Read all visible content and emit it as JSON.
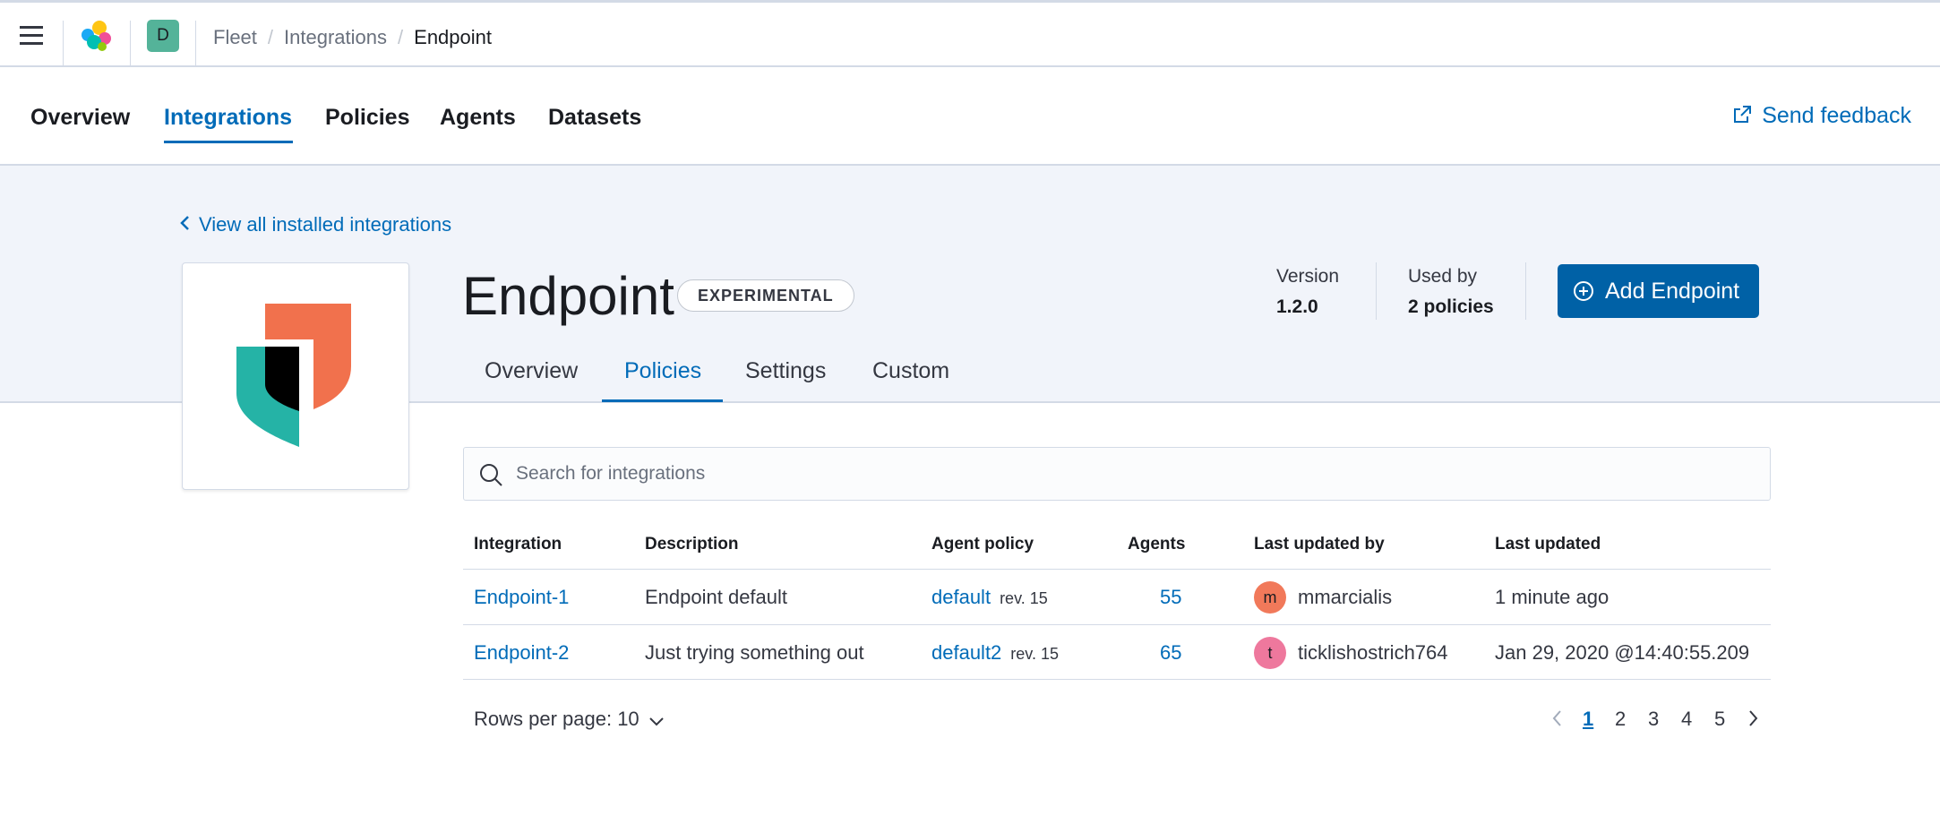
{
  "header": {
    "space_initial": "D",
    "breadcrumbs": [
      "Fleet",
      "Integrations",
      "Endpoint"
    ]
  },
  "main_nav": {
    "tabs": [
      "Overview",
      "Integrations",
      "Policies",
      "Agents",
      "Datasets"
    ],
    "active_tab": "Integrations",
    "feedback_label": "Send feedback"
  },
  "integration": {
    "back_link": "View all installed integrations",
    "title": "Endpoint",
    "badge": "EXPERIMENTAL",
    "version_label": "Version",
    "version_value": "1.2.0",
    "used_by_label": "Used by",
    "used_by_value": "2 policies",
    "add_button": "Add Endpoint",
    "subtabs": [
      "Overview",
      "Policies",
      "Settings",
      "Custom"
    ],
    "active_subtab": "Policies"
  },
  "search": {
    "placeholder": "Search for integrations"
  },
  "table": {
    "columns": [
      "Integration",
      "Description",
      "Agent policy",
      "Agents",
      "Last updated by",
      "Last updated"
    ],
    "rows": [
      {
        "integration": "Endpoint-1",
        "description": "Endpoint default",
        "agent_policy": "default",
        "revision": "rev. 15",
        "agents": "55",
        "user_initial": "m",
        "user": "mmarcialis",
        "avatar_color": "#f1795a",
        "last_updated": "1 minute ago"
      },
      {
        "integration": "Endpoint-2",
        "description": "Just trying something out",
        "agent_policy": "default2",
        "revision": "rev. 15",
        "agents": "65",
        "user_initial": "t",
        "user": "ticklishostrich764",
        "avatar_color": "#ee789d",
        "last_updated": "Jan 29, 2020 @14:40:55.209"
      }
    ]
  },
  "pagination": {
    "rows_per_page": "Rows per page: 10",
    "pages": [
      "1",
      "2",
      "3",
      "4",
      "5"
    ],
    "current_page": "1"
  },
  "colors": {
    "accent": "#006bb8",
    "primary_button": "#0061a6",
    "header_band": "#f1f4fa"
  }
}
